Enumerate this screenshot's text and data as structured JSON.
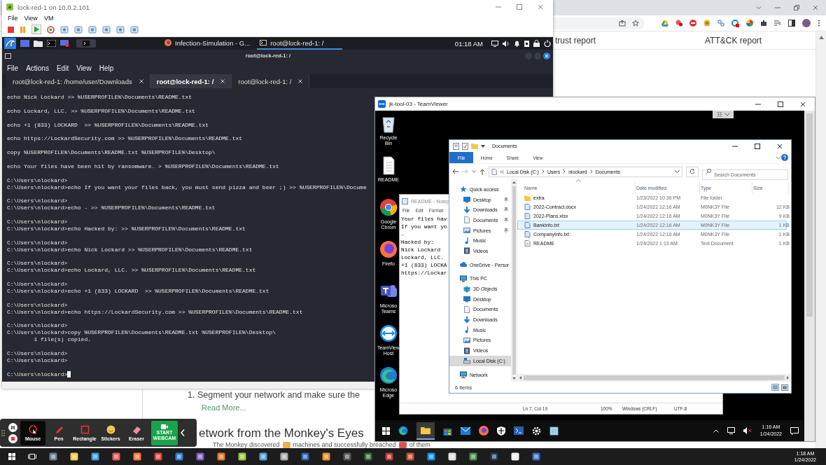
{
  "browser": {
    "columns": [
      "trust report",
      "ATT&CK report"
    ],
    "list_item": "1. Segment your network and make sure the",
    "link": "Read More...",
    "heading": "etwork from the Monkey's Eyes",
    "summary": [
      "The Monkey discovered",
      "machines and successfully breached",
      "of them"
    ]
  },
  "vm": {
    "title": "lock-red-1 on 10.0.2.101",
    "menu": [
      "File",
      "View",
      "VM"
    ],
    "panel": {
      "tasks": [
        {
          "label": "Infection-Simulation - G...",
          "kind": "browser",
          "selected": false
        },
        {
          "label": "root@lock-red-1: /",
          "kind": "terminal",
          "selected": true
        }
      ],
      "clock": "01:18 AM"
    },
    "terminal": {
      "title": "root@lock-red-1: /",
      "menu": [
        "File",
        "Actions",
        "Edit",
        "View",
        "Help"
      ],
      "tabs": [
        {
          "label": "root@lock-red-1: /home/user/Downloads",
          "selected": false
        },
        {
          "label": "root@lock-red-1: /",
          "selected": true
        },
        {
          "label": "root@lock-red-1: /",
          "selected": false
        }
      ],
      "blocks": [
        [
          "echo Nick Lockard >> %USERPROFILE%\\Documents\\README.txt"
        ],
        [
          "echo Lockard, LLC. >> %USERPROFILE%\\Documents\\README.txt"
        ],
        [
          "echo +1 (833) LOCKARD  >> %USERPROFILE%\\Documents\\README.txt"
        ],
        [
          "echo https://LockardSecurity.com >> %USERPROFILE%\\Documents\\README.txt"
        ],
        [
          "copy %USERPROFILE%\\Documents\\README.txt %USERPROFILE%\\Desktop\\"
        ],
        [
          "echo Your files have been hit by ransomware. > %USERPROFILE%\\Documents\\README.txt"
        ],
        [
          "C:\\Users\\nlockard>",
          "C:\\Users\\nlockard>echo If you want your files back, you must send pizza and beer ;) >> %USERPROFILE%\\Docume"
        ],
        [
          "C:\\Users\\nlockard>",
          "C:\\Users\\nlockard>echo - >> %USERPROFILE%\\Documents\\README.txt"
        ],
        [
          "C:\\Users\\nlockard>",
          "C:\\Users\\nlockard>echo Hacked by: >> %USERPROFILE%\\Documents\\README.txt"
        ],
        [
          "C:\\Users\\nlockard>",
          "C:\\Users\\nlockard>echo Nick Lockard >> %USERPROFILE%\\Documents\\README.txt"
        ],
        [
          "C:\\Users\\nlockard>",
          "C:\\Users\\nlockard>echo Lockard, LLC. >> %USERPROFILE%\\Documents\\README.txt"
        ],
        [
          "C:\\Users\\nlockard>",
          "C:\\Users\\nlockard>echo +1 (833) LOCKARD  >> %USERPROFILE%\\Documents\\README.txt"
        ],
        [
          "C:\\Users\\nlockard>",
          "C:\\Users\\nlockard>echo https://LockardSecurity.com >> %USERPROFILE%\\Documents\\README.txt"
        ],
        [
          "C:\\Users\\nlockard>",
          "C:\\Users\\nlockard>copy %USERPROFILE%\\Documents\\README.txt %USERPROFILE%\\Desktop\\",
          "        1 file(s) copied."
        ],
        [
          "C:\\Users\\nlockard>",
          "C:\\Users\\nlockard>"
        ],
        [
          "C:\\Users\\nlockard>"
        ]
      ]
    }
  },
  "teamviewer": {
    "title": "jk-tool-03 - TeamViewer",
    "desktop_icons": [
      {
        "kind": "recycle",
        "label": "Recycle Bin"
      },
      {
        "kind": "document",
        "label": "README"
      },
      {
        "kind": "chrome",
        "label": "Google Chrom"
      },
      {
        "kind": "firefox",
        "label": "Firefo"
      },
      {
        "kind": "teams",
        "label": "Microso Teams"
      },
      {
        "kind": "teamviewer",
        "label": "TeamView Host"
      },
      {
        "kind": "edge",
        "label": "Microso Edge"
      }
    ],
    "notepad": {
      "title": "README - Notep",
      "menu": [
        "File",
        "Edit",
        "Format"
      ],
      "lines": [
        "Your files hav",
        "If you want yo",
        "-",
        "Hacked by:",
        "Nick Lockard",
        "Lockard, LLC.",
        "+1 (833) LOCKA",
        "https://Lockar"
      ],
      "status": [
        "Ln 7, Col 19",
        "100%",
        "Windows (CRLF)",
        "UTF-8"
      ]
    },
    "explorer": {
      "title": "Documents",
      "ribbon": [
        {
          "label": "File",
          "kind": "file"
        },
        {
          "label": "Home",
          "kind": "tab"
        },
        {
          "label": "Share",
          "kind": "tab"
        },
        {
          "label": "View",
          "kind": "tab"
        }
      ],
      "path": [
        "Local Disk (C:)",
        "Users",
        "nlockard",
        "Documents"
      ],
      "search": {
        "placeholder": "Search Documents"
      },
      "nav": [
        {
          "label": "Quick access",
          "kind": "star",
          "selected": false,
          "children": [
            {
              "label": "Desktop",
              "kind": "desktop",
              "pinned": true,
              "selected": false
            },
            {
              "label": "Downloads",
              "kind": "downloads",
              "pinned": true,
              "selected": false
            },
            {
              "label": "Documents",
              "kind": "documents",
              "pinned": true,
              "selected": false
            },
            {
              "label": "Pictures",
              "kind": "pictures",
              "pinned": true,
              "selected": false
            },
            {
              "label": "Music",
              "kind": "music",
              "pinned": false,
              "selected": false
            },
            {
              "label": "Videos",
              "kind": "videos",
              "pinned": false,
              "selected": false
            }
          ]
        },
        {
          "label": "OneDrive - Persor",
          "kind": "cloud",
          "selected": false
        },
        {
          "label": "This PC",
          "kind": "pc",
          "selected": false,
          "children": [
            {
              "label": "3D Objects",
              "kind": "cube",
              "selected": false
            },
            {
              "label": "Desktop",
              "kind": "desktop",
              "selected": false
            },
            {
              "label": "Documents",
              "kind": "documents",
              "selected": false
            },
            {
              "label": "Downloads",
              "kind": "downloads",
              "selected": false
            },
            {
              "label": "Music",
              "kind": "music",
              "selected": false
            },
            {
              "label": "Pictures",
              "kind": "pictures",
              "selected": false
            },
            {
              "label": "Videos",
              "kind": "videos",
              "selected": false
            },
            {
              "label": "Local Disk (C:)",
              "kind": "disk",
              "selected": true
            }
          ]
        },
        {
          "label": "Network",
          "kind": "network",
          "selected": false
        }
      ],
      "columns": [
        "Name",
        "Date modified",
        "Type",
        "Size"
      ],
      "rows": [
        {
          "kind": "folder",
          "name": "extra",
          "date": "1/23/2022 10:36 PM",
          "type": "File folder",
          "selected": false
        },
        {
          "kind": "file",
          "name": "2022-Contract.docx",
          "date": "1/24/2022 12:16 AM",
          "type": "M0NK3Y File",
          "size": "12 KB",
          "selected": false
        },
        {
          "kind": "file",
          "name": "2022-Plans.xlsx",
          "date": "1/24/2022 12:16 AM",
          "type": "M0NK3Y File",
          "size": "9 KB",
          "selected": false
        },
        {
          "kind": "file",
          "name": "BankInfo.txt",
          "date": "1/24/2022 12:16 AM",
          "type": "M0NK3Y File",
          "size": "1 KB",
          "selected": true
        },
        {
          "kind": "file",
          "name": "CompanyInfo.txt",
          "date": "1/24/2022 12:16 AM",
          "type": "M0NK3Y File",
          "size": "1 KB",
          "selected": false
        },
        {
          "kind": "text",
          "name": "README",
          "date": "1/24/2022 1:13 AM",
          "type": "Text Document",
          "size": "1 KB",
          "selected": false
        }
      ],
      "status": "6 items"
    },
    "taskbar": {
      "time": "1:16 AM",
      "date": "1/24/2022"
    }
  },
  "annotation_toolbar": {
    "tools": [
      {
        "label": "Mouse",
        "kind": "mouse",
        "selected": true
      },
      {
        "label": "Pen",
        "kind": "pen",
        "selected": false
      },
      {
        "label": "Rectangle",
        "kind": "rectangle",
        "selected": false
      },
      {
        "label": "Stickers",
        "kind": "stickers",
        "selected": false
      },
      {
        "label": "Eraser",
        "kind": "eraser",
        "selected": false
      }
    ],
    "webcam": "START WEBCAM"
  },
  "taskbar": {
    "time": "1:18 AM",
    "date": "1/24/2022"
  }
}
